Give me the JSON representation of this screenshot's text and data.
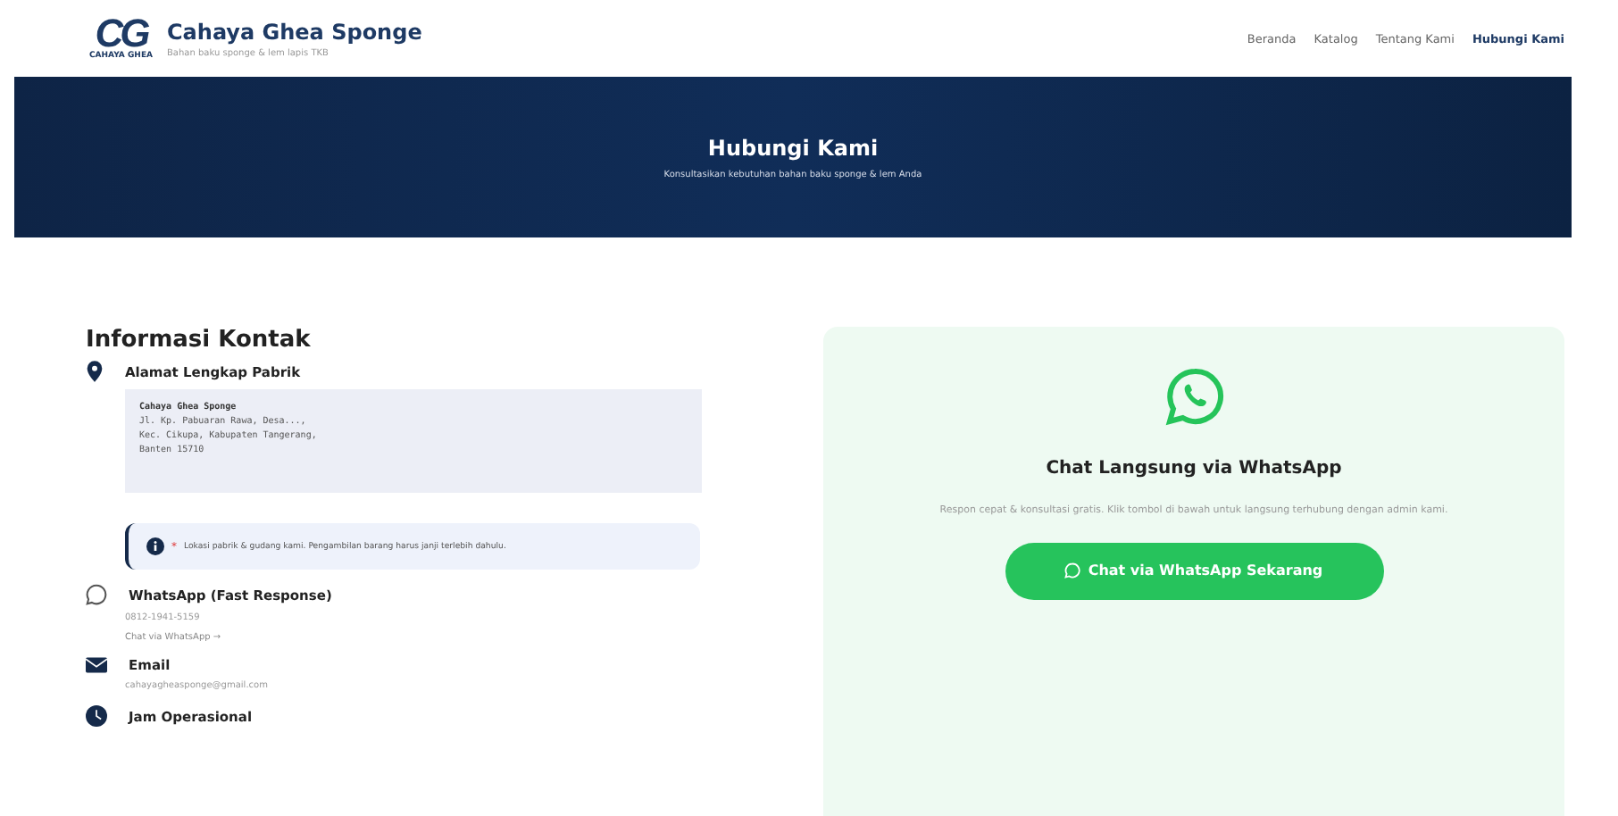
{
  "brand": {
    "logo": "CG",
    "logo_caption": "CAHAYA GHEA",
    "name": "Cahaya Ghea Sponge",
    "tagline": "Bahan baku sponge & lem lapis TKB"
  },
  "nav": [
    {
      "label": "Beranda",
      "selected": false
    },
    {
      "label": "Katalog",
      "selected": false
    },
    {
      "label": "Tentang Kami",
      "selected": false
    },
    {
      "label": "Hubungi Kami",
      "selected": true
    }
  ],
  "hero": {
    "title": "Hubungi Kami",
    "subtitle": "Konsultasikan kebutuhan bahan baku sponge & lem Anda"
  },
  "contact": {
    "heading": "Informasi Kontak",
    "items": [
      {
        "kind": "address",
        "label": "Alamat Lengkap Pabrik",
        "lines": [
          "Cahaya Ghea Sponge",
          "Jl. Kp. Pabuaran Rawa, Desa...,",
          "Kec. Cikupa, Kabupaten Tangerang,",
          "Banten 15710"
        ],
        "note_mark": "*",
        "note": "Lokasi pabrik & gudang kami. Pengambilan barang harus janji terlebih dahulu."
      },
      {
        "kind": "whatsapp",
        "label": "WhatsApp (Fast Response)",
        "value": "0812-1941-5159",
        "link": "Chat via WhatsApp →"
      },
      {
        "kind": "email",
        "label": "Email",
        "value": "cahayagheasponge@gmail.com"
      },
      {
        "kind": "hours",
        "label": "Jam Operasional"
      }
    ]
  },
  "whatsapp_card": {
    "title": "Chat Langsung via WhatsApp",
    "text": "Respon cepat & konsultasi gratis. Klik tombol di bawah untuk langsung terhubung dengan admin kami.",
    "button": "Chat via WhatsApp Sekarang"
  }
}
